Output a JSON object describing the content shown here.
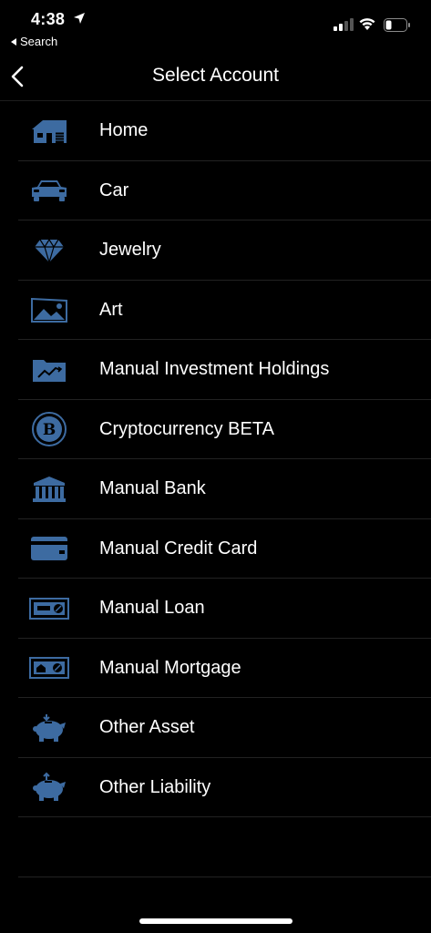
{
  "status": {
    "time": "4:38",
    "back_label": "Search"
  },
  "nav": {
    "title": "Select Account"
  },
  "colors": {
    "icon": "#3d6ba1",
    "background": "#000000",
    "divider": "#222222"
  },
  "accounts": [
    {
      "label": "Home",
      "icon": "house-icon"
    },
    {
      "label": "Car",
      "icon": "car-icon"
    },
    {
      "label": "Jewelry",
      "icon": "diamond-icon"
    },
    {
      "label": "Art",
      "icon": "picture-icon"
    },
    {
      "label": "Manual Investment Holdings",
      "icon": "investment-folder-icon"
    },
    {
      "label": "Cryptocurrency BETA",
      "icon": "bitcoin-icon"
    },
    {
      "label": "Manual Bank",
      "icon": "bank-icon"
    },
    {
      "label": "Manual Credit Card",
      "icon": "credit-card-icon"
    },
    {
      "label": "Manual Loan",
      "icon": "loan-icon"
    },
    {
      "label": "Manual Mortgage",
      "icon": "mortgage-icon"
    },
    {
      "label": "Other Asset",
      "icon": "piggy-bank-in-icon"
    },
    {
      "label": "Other Liability",
      "icon": "piggy-bank-out-icon"
    }
  ]
}
